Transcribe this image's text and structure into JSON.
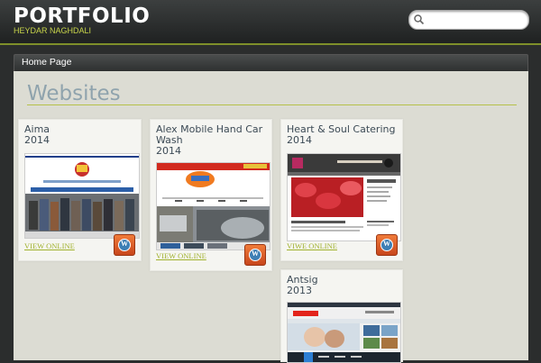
{
  "header": {
    "title": "PORTFOLIO",
    "subtitle": "HEYDAR NAGHDALI",
    "search_placeholder": ""
  },
  "nav": {
    "home": "Home Page"
  },
  "main": {
    "title": "Websites",
    "cards": [
      {
        "title": "Aima",
        "year": "2014",
        "link": "VIEW ONLINE"
      },
      {
        "title": "Alex Mobile Hand Car Wash",
        "year": "2014",
        "link": "VIEW ONLINE"
      },
      {
        "title": "Heart & Soul Catering",
        "year": "2014",
        "link": "VIWE ONLINE"
      },
      {
        "title": "Antsig",
        "year": "2013",
        "link": ""
      }
    ]
  },
  "colors": {
    "accent": "#c7d44a",
    "link": "#a1b22e",
    "title": "#8fa3ad",
    "content_bg": "#dcdcd3"
  }
}
